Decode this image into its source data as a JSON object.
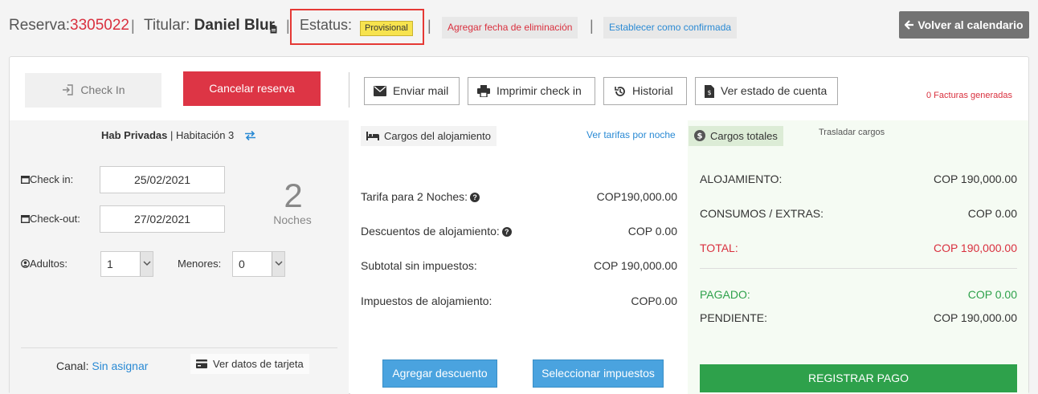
{
  "header": {
    "reserva_label": "Reserva:",
    "reserva_number": "3305022",
    "sep1": "|",
    "titular_label": "Titular:",
    "titular_name": "Daniel Blur",
    "sep2": "|",
    "status_label": "Estatus:",
    "status_value": "Provisional",
    "sep3": "|",
    "sep4": "|",
    "add_deletion_date": "Agregar fecha de eliminación",
    "set_confirmed": "Establecer como confirmada",
    "back_calendar": "Volver al calendario"
  },
  "toolbar": {
    "checkin": "Check In",
    "cancel": "Cancelar reserva",
    "send_mail": "Enviar mail",
    "print_checkin": "Imprimir check in",
    "history": "Historial",
    "account_status": "Ver estado de cuenta",
    "invoices": "0 Facturas generadas"
  },
  "room": {
    "type": "Hab Privadas",
    "sep": "|",
    "name": "Habitación 3",
    "checkin_label": "Check in:",
    "checkin_value": "25/02/2021",
    "checkout_label": "Check-out:",
    "checkout_value": "27/02/2021",
    "nights_count": "2",
    "nights_label": "Noches",
    "adults_label": "Adultos:",
    "adults_value": "1",
    "minors_label": "Menores:",
    "minors_value": "0",
    "channel_label": "Canal:",
    "channel_value": "Sin asignar",
    "card_button": "Ver datos de tarjeta"
  },
  "lodging": {
    "tab_label": "Cargos del alojamiento",
    "rates_link": "Ver tarifas por noche",
    "rows": [
      {
        "label": "Tarifa para 2 Noches:",
        "value": "COP190,000.00"
      },
      {
        "label": "Descuentos de alojamiento:",
        "value": "COP 0.00"
      },
      {
        "label": "Subtotal sin impuestos:",
        "value": "COP 190,000.00"
      },
      {
        "label": "Impuestos de alojamiento:",
        "value": "COP0.00"
      }
    ],
    "add_discount": "Agregar descuento",
    "select_taxes": "Seleccionar impuestos"
  },
  "totals": {
    "tab_label": "Cargos totales",
    "transfer_link": "Trasladar cargos",
    "alojamiento_label": "ALOJAMIENTO:",
    "alojamiento_value": "COP 190,000.00",
    "consumos_label": "CONSUMOS / EXTRAS:",
    "consumos_value": "COP 0.00",
    "total_label": "TOTAL:",
    "total_value": "COP 190,000.00",
    "pagado_label": "PAGADO:",
    "pagado_value": "COP 0.00",
    "pendiente_label": "PENDIENTE:",
    "pendiente_value": "COP 190,000.00",
    "register_payment": "REGISTRAR PAGO"
  },
  "colors": {
    "accent_red": "#dd3545",
    "status_yellow": "#f7e34e",
    "link_blue": "#2a8ad4",
    "button_blue": "#4aa3df",
    "pay_green": "#2ea14b"
  }
}
